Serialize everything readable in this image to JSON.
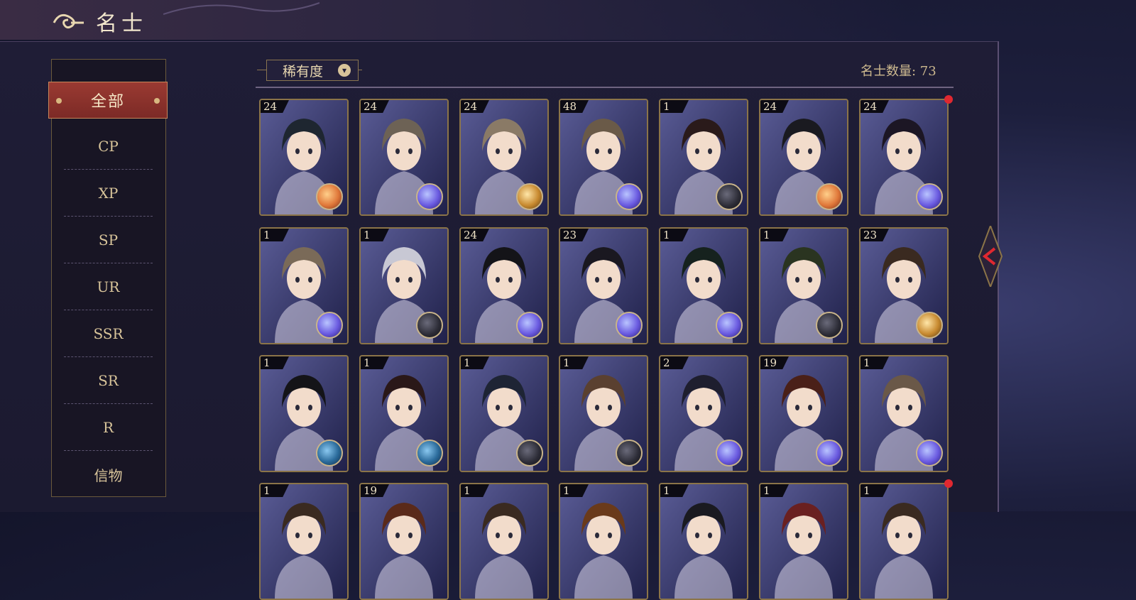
{
  "header": {
    "title": "名士"
  },
  "sidebar": {
    "active": "全部",
    "items": [
      "CP",
      "XP",
      "SP",
      "UR",
      "SSR",
      "SR",
      "R",
      "信物"
    ]
  },
  "filter": {
    "label": "稀有度"
  },
  "count_text": "名士数量: 73",
  "colors": {
    "accent": "#9a3a32",
    "gold_border": "#8b7448",
    "background": "#1b1a30",
    "notification": "#e02830"
  },
  "cards": [
    {
      "level": "24",
      "badge": "orange-orb-icon",
      "hair": "#1e2630"
    },
    {
      "level": "24",
      "badge": "purple-orb-icon",
      "hair": "#6d6255"
    },
    {
      "level": "24",
      "badge": "gold-orb-icon",
      "hair": "#8a7a66"
    },
    {
      "level": "48",
      "badge": "purple-orb-icon",
      "hair": "#6a5a48"
    },
    {
      "level": "1",
      "badge": "dark-orb-icon",
      "hair": "#2a1a1a"
    },
    {
      "level": "24",
      "badge": "orange-orb-icon",
      "hair": "#1a1a20"
    },
    {
      "level": "24",
      "badge": "purple-orb-icon",
      "hair": "#1c1624"
    },
    {
      "level": "1",
      "badge": "purple-orb-icon",
      "hair": "#7a6a58"
    },
    {
      "level": "1",
      "badge": "dark-orb-icon",
      "hair": "#c8c8d4"
    },
    {
      "level": "24",
      "badge": "purple-orb-icon",
      "hair": "#141418"
    },
    {
      "level": "23",
      "badge": "purple-orb-icon",
      "hair": "#1a1820"
    },
    {
      "level": "1",
      "badge": "purple-orb-icon",
      "hair": "#16221e"
    },
    {
      "level": "1",
      "badge": "dark-orb-icon",
      "hair": "#2a3420"
    },
    {
      "level": "23",
      "badge": "gold-orb-icon",
      "hair": "#3a2a20"
    },
    {
      "level": "1",
      "badge": "blue-orb-icon",
      "hair": "#141418"
    },
    {
      "level": "1",
      "badge": "blue-orb-icon",
      "hair": "#2a1818"
    },
    {
      "level": "1",
      "badge": "dark-orb-icon",
      "hair": "#1e2434"
    },
    {
      "level": "1",
      "badge": "dark-orb-icon",
      "hair": "#5a4030"
    },
    {
      "level": "2",
      "badge": "purple-orb-icon",
      "hair": "#1e1e2e"
    },
    {
      "level": "19",
      "badge": "purple-orb-icon",
      "hair": "#4a2018"
    },
    {
      "level": "1",
      "badge": "purple-orb-icon",
      "hair": "#6a5848"
    },
    {
      "level": "1",
      "badge": "",
      "hair": "#3a2a20"
    },
    {
      "level": "19",
      "badge": "",
      "hair": "#5a2a1a"
    },
    {
      "level": "1",
      "badge": "",
      "hair": "#3a2a20"
    },
    {
      "level": "1",
      "badge": "",
      "hair": "#6a3a1a"
    },
    {
      "level": "1",
      "badge": "",
      "hair": "#1a1a20"
    },
    {
      "level": "1",
      "badge": "",
      "hair": "#6a2020"
    },
    {
      "level": "1",
      "badge": "",
      "hair": "#3a2a20"
    }
  ],
  "notifications": [
    6,
    27
  ]
}
